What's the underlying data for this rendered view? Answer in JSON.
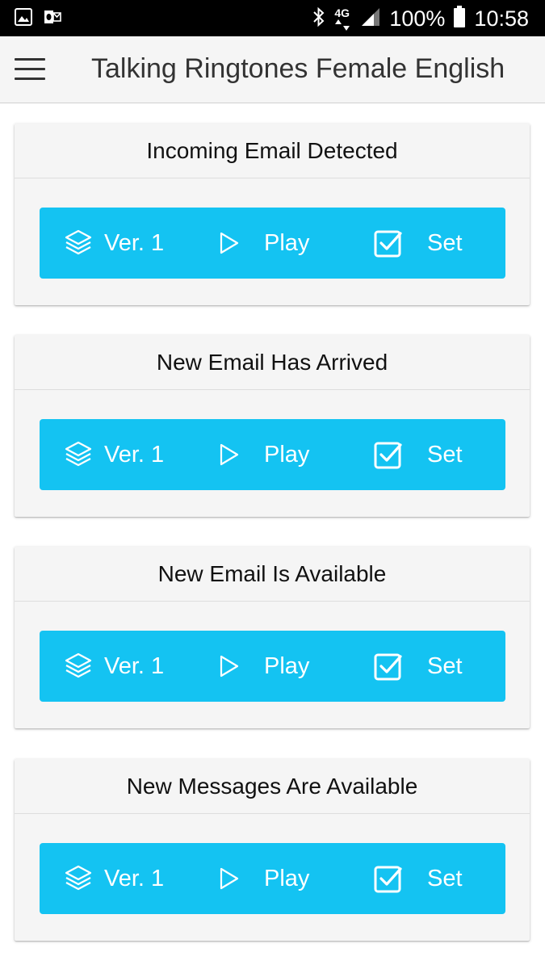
{
  "status_bar": {
    "left_icons": [
      "image-icon",
      "outlook-icon"
    ],
    "right_icons": [
      "bluetooth-icon",
      "network-4g-icon",
      "signal-icon",
      "battery-icon"
    ],
    "network": "4G",
    "battery": "100%",
    "time": "10:58"
  },
  "app_bar": {
    "menu_icon": "hamburger-menu-icon",
    "title": "Talking Ringtones Female English"
  },
  "colors": {
    "accent": "#14c3f2",
    "card_bg": "#f5f5f5",
    "status_bg": "#000000"
  },
  "cards": [
    {
      "title": "Incoming Email Detected",
      "version_label": "Ver. 1",
      "play_label": "Play",
      "set_label": "Set"
    },
    {
      "title": "New Email Has Arrived",
      "version_label": "Ver. 1",
      "play_label": "Play",
      "set_label": "Set"
    },
    {
      "title": "New Email Is Available",
      "version_label": "Ver. 1",
      "play_label": "Play",
      "set_label": "Set"
    },
    {
      "title": "New Messages Are Available",
      "version_label": "Ver. 1",
      "play_label": "Play",
      "set_label": "Set"
    }
  ],
  "icons": {
    "version": "layers-icon",
    "play": "play-icon",
    "set": "checkbox-checked-icon"
  }
}
